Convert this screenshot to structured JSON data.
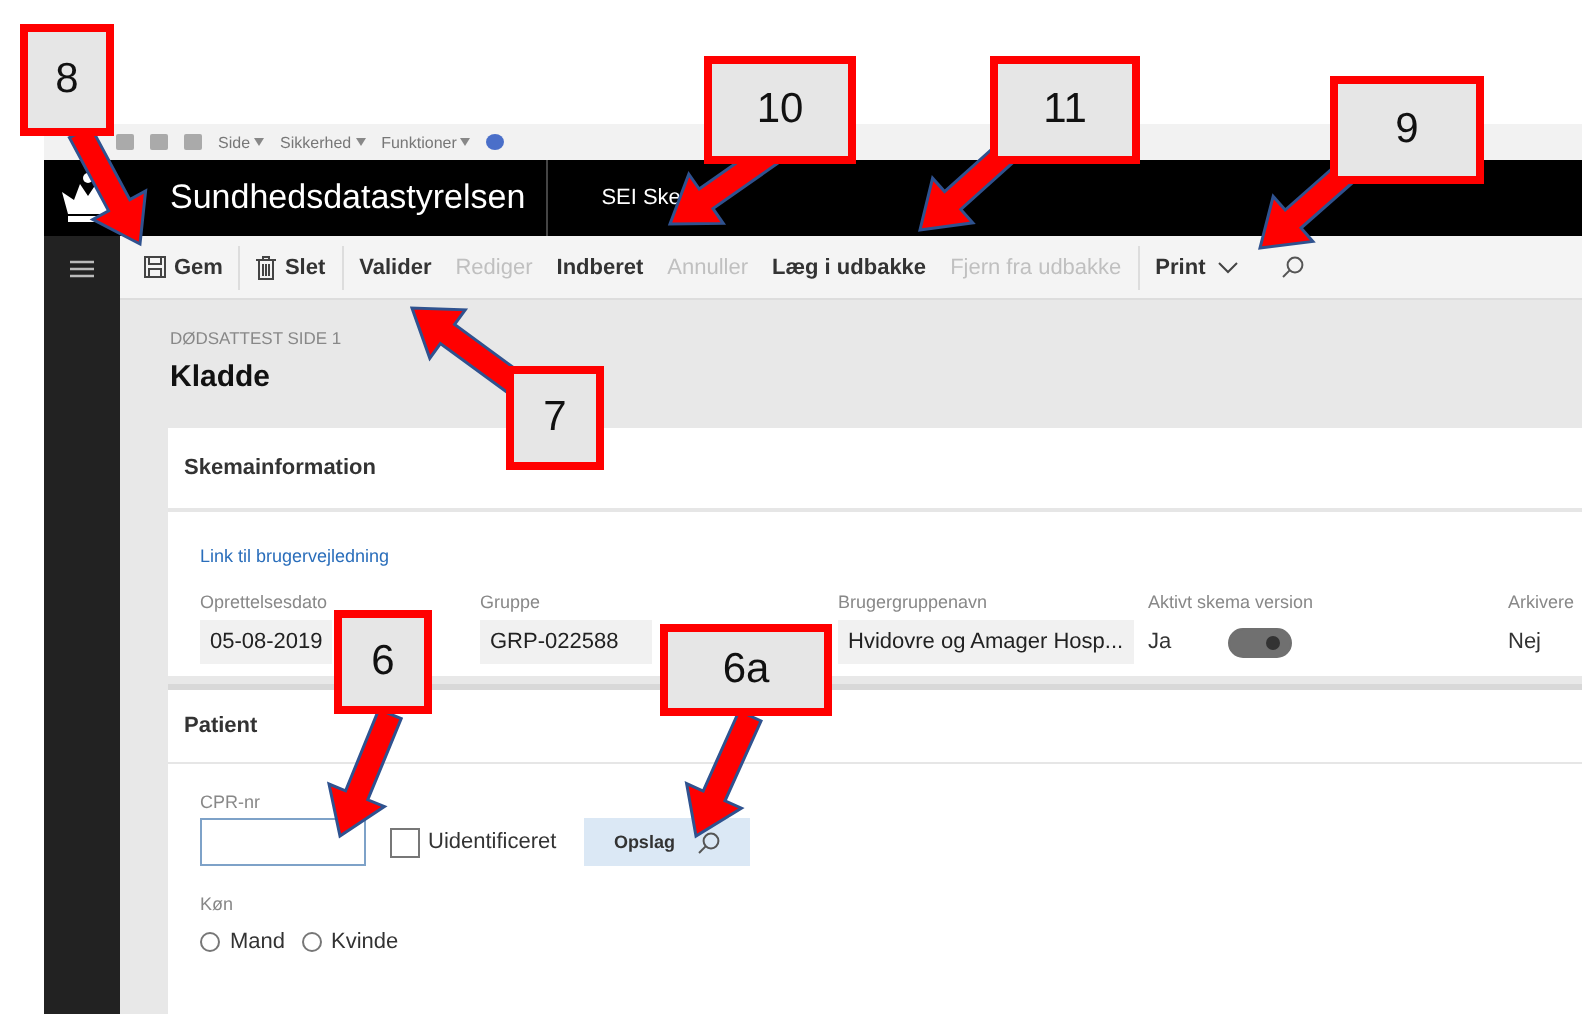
{
  "browser_bar": {
    "menus": [
      "Side",
      "Sikkerhed",
      "Funktioner"
    ]
  },
  "header": {
    "brand": "Sundhedsdatastyrelsen",
    "app": "SEI Ske"
  },
  "toolbar": {
    "groups": [
      [
        {
          "kind": "save",
          "label": "Gem",
          "disabled": false
        }
      ],
      [
        {
          "kind": "delete",
          "label": "Slet",
          "disabled": false
        }
      ],
      [
        {
          "kind": "text",
          "label": "Valider",
          "disabled": false
        },
        {
          "kind": "text",
          "label": "Rediger",
          "disabled": true
        },
        {
          "kind": "text",
          "label": "Indberet",
          "disabled": false
        },
        {
          "kind": "text",
          "label": "Annuller",
          "disabled": true
        },
        {
          "kind": "text",
          "label": "Læg i udbakke",
          "disabled": false
        },
        {
          "kind": "text",
          "label": "Fjern fra udbakke",
          "disabled": true
        }
      ],
      [
        {
          "kind": "dropdown",
          "label": "Print",
          "disabled": false
        },
        {
          "kind": "search",
          "disabled": false
        }
      ]
    ]
  },
  "page": {
    "breadcrumb": "DØDSATTEST SIDE 1",
    "title": "Kladde"
  },
  "skemainformation": {
    "title": "Skemainformation",
    "link": "Link til brugervejledning",
    "fields": [
      {
        "kind": "field",
        "label": "Oprettelsesdato",
        "value": "05-08-2019"
      },
      {
        "kind": "field",
        "label": "Gruppe",
        "value": "GRP-022588"
      },
      {
        "kind": "field",
        "label": "Brugergruppenavn",
        "value": "Hvidovre og Amager Hosp..."
      },
      {
        "kind": "toggle",
        "label": "Aktivt skema version",
        "value": "Ja",
        "on": true
      },
      {
        "kind": "plain",
        "label": "Arkivere",
        "value": "Nej"
      }
    ]
  },
  "patient": {
    "title": "Patient",
    "cpr_label": "CPR-nr",
    "unidentified": {
      "label": "Uidentificeret",
      "checked": false
    },
    "lookup_button": "Opslag",
    "gender_label": "Køn",
    "gender_options": [
      {
        "label": "Mand",
        "selected": false
      },
      {
        "label": "Kvinde",
        "selected": false
      }
    ]
  },
  "callouts": [
    {
      "label": "8"
    },
    {
      "label": "10"
    },
    {
      "label": "11"
    },
    {
      "label": "9"
    },
    {
      "label": "7"
    },
    {
      "label": "6"
    },
    {
      "label": "6a"
    }
  ]
}
